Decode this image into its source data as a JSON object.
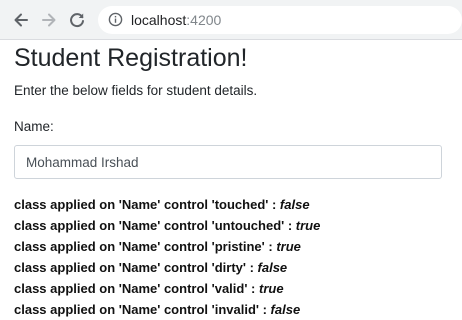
{
  "browser": {
    "address_host": "localhost",
    "address_port": ":4200",
    "icons": [
      "back-arrow-icon",
      "forward-arrow-icon",
      "reload-icon",
      "info-icon"
    ]
  },
  "page": {
    "title": "Student Registration!",
    "subtitle": "Enter the below fields for student details.",
    "name_label": "Name:",
    "name_value": "Mohammad Irshad"
  },
  "states": [
    {
      "prefix": "class applied on 'Name' control 'touched' : ",
      "value": "false"
    },
    {
      "prefix": "class applied on 'Name' control 'untouched' : ",
      "value": "true"
    },
    {
      "prefix": "class applied on 'Name' control 'pristine' : ",
      "value": "true"
    },
    {
      "prefix": "class applied on 'Name' control 'dirty' : ",
      "value": "false"
    },
    {
      "prefix": "class applied on 'Name' control 'valid' : ",
      "value": "true"
    },
    {
      "prefix": "class applied on 'Name' control 'invalid' : ",
      "value": "false"
    }
  ]
}
